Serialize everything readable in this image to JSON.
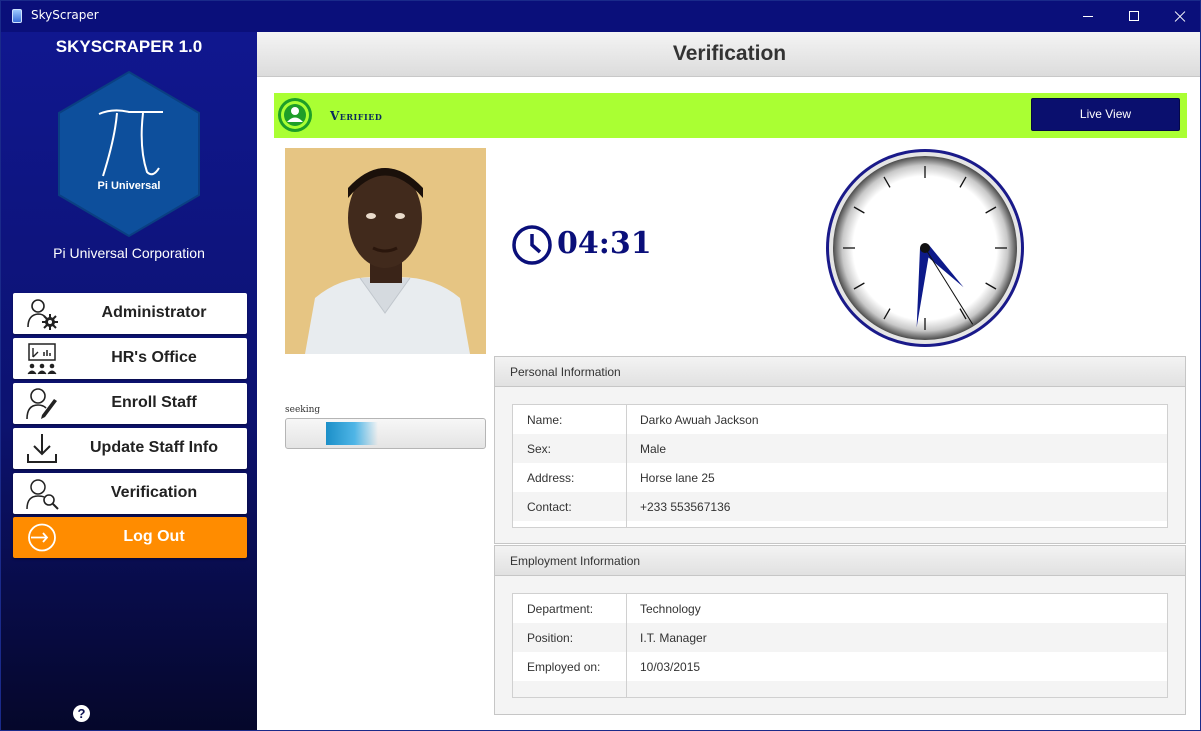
{
  "window": {
    "title": "SkyScraper"
  },
  "sidebar": {
    "app_name": "SKYSCRAPER 1.0",
    "logo_caption": "Pi Universal",
    "corporation": "Pi Universal Corporation",
    "items": [
      {
        "label": "Administrator",
        "icon": "admin-settings-icon"
      },
      {
        "label": "HR's Office",
        "icon": "presentation-icon"
      },
      {
        "label": "Enroll Staff",
        "icon": "enroll-user-icon"
      },
      {
        "label": "Update Staff Info",
        "icon": "download-icon"
      },
      {
        "label": "Verification",
        "icon": "user-search-icon"
      },
      {
        "label": "Log Out",
        "icon": "logout-icon"
      }
    ],
    "help_symbol": "?"
  },
  "page": {
    "title": "Verification"
  },
  "status": {
    "text": "Verified",
    "color": "#aaff33",
    "live_view_label": "Live View"
  },
  "scanner": {
    "status_label": "seeking",
    "progress_fraction": 0.3
  },
  "clock": {
    "digital": "04:31",
    "analog_hour": 4,
    "analog_minute": 31
  },
  "personal_info": {
    "title": "Personal Information",
    "rows": [
      {
        "key": "Name:",
        "value": "Darko Awuah Jackson"
      },
      {
        "key": "Sex:",
        "value": "Male"
      },
      {
        "key": "Address:",
        "value": "Horse lane 25"
      },
      {
        "key": "Contact:",
        "value": "+233 553567136"
      }
    ]
  },
  "employment_info": {
    "title": "Employment Information",
    "rows": [
      {
        "key": "Department:",
        "value": "Technology"
      },
      {
        "key": "Position:",
        "value": "I.T. Manager"
      },
      {
        "key": "Employed on:",
        "value": "10/03/2015"
      }
    ]
  },
  "colors": {
    "sidebar_bg": "#10178f",
    "accent": "#0a0f7a",
    "logout": "#ff8c00",
    "verified": "#aaff33",
    "logo_hex": "#0d4f9c"
  }
}
